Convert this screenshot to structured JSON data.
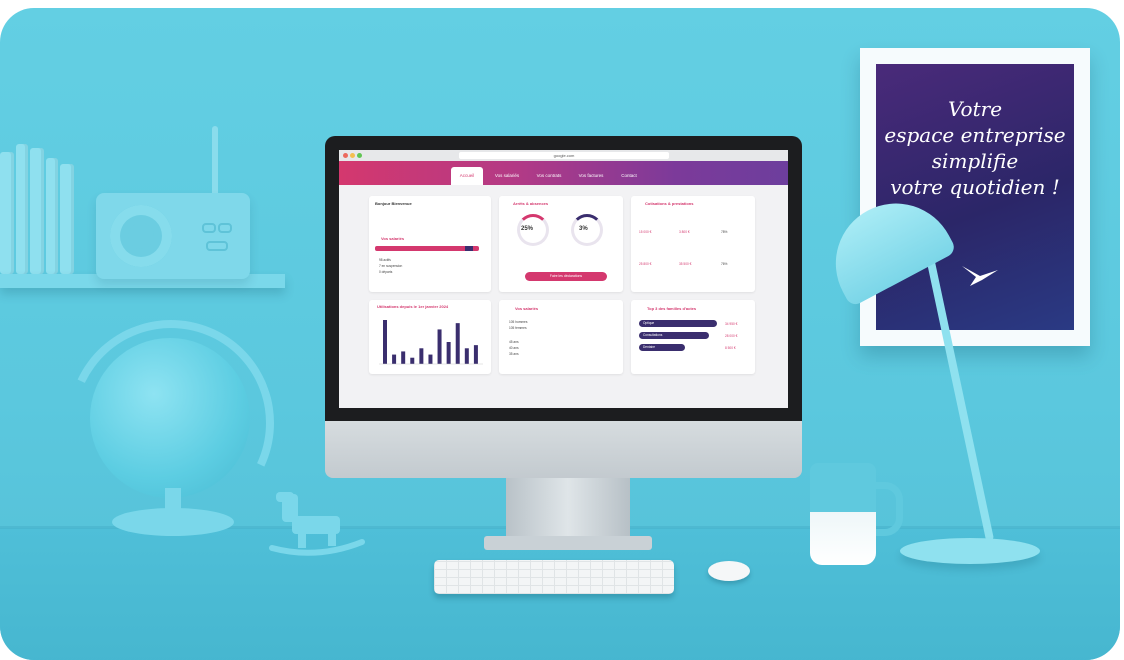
{
  "poster": {
    "line1": "Votre",
    "line2": "espace entreprise",
    "line3": "simplifie",
    "line4": "votre quotidien !"
  },
  "browser": {
    "url": "google.com"
  },
  "nav": {
    "tabs": [
      "Accueil",
      "Vos salariés",
      "Vos contrats",
      "Vos factures",
      "Contact"
    ]
  },
  "cards": {
    "welcome": {
      "title": "Bonjour Bienvenue",
      "effectifs_title": "Vos salariés",
      "items": [
        "98 actifs",
        "7 en suspension",
        "0 départs"
      ]
    },
    "arrets": {
      "title": "Arrêts & absences",
      "pct1": "25%",
      "pct2": "3%",
      "button": "Faire les déclarations"
    },
    "cotisations": {
      "title": "Cotisations & prestations",
      "v1": "15 000 €",
      "v2": "3 800 €",
      "v3": "78%",
      "v4": "25 800 €",
      "v5": "35 500 €",
      "v6": "76%"
    },
    "chart": {
      "title": "Utilisations depuis le 1er janvier 2024"
    },
    "salaries": {
      "title": "Vos salariés",
      "rows": [
        "105 hommes",
        "105 femmes",
        "45 ans",
        "40 ans",
        "35 ans"
      ]
    },
    "top": {
      "title": "Top 3 des familles d'actes",
      "rows": [
        "Optique",
        "Consultations",
        "Dentaire"
      ],
      "amounts": [
        "34 950 €",
        "28 000 €",
        "8 500 €"
      ]
    }
  },
  "colors": {
    "brand_pink": "#d4386e",
    "brand_purple": "#6d3e9d",
    "navy": "#3a2e6e",
    "wall": "#5bc8de"
  },
  "chart_bars": [
    28,
    6,
    8,
    4,
    10,
    6,
    22,
    14,
    26,
    10,
    12
  ]
}
